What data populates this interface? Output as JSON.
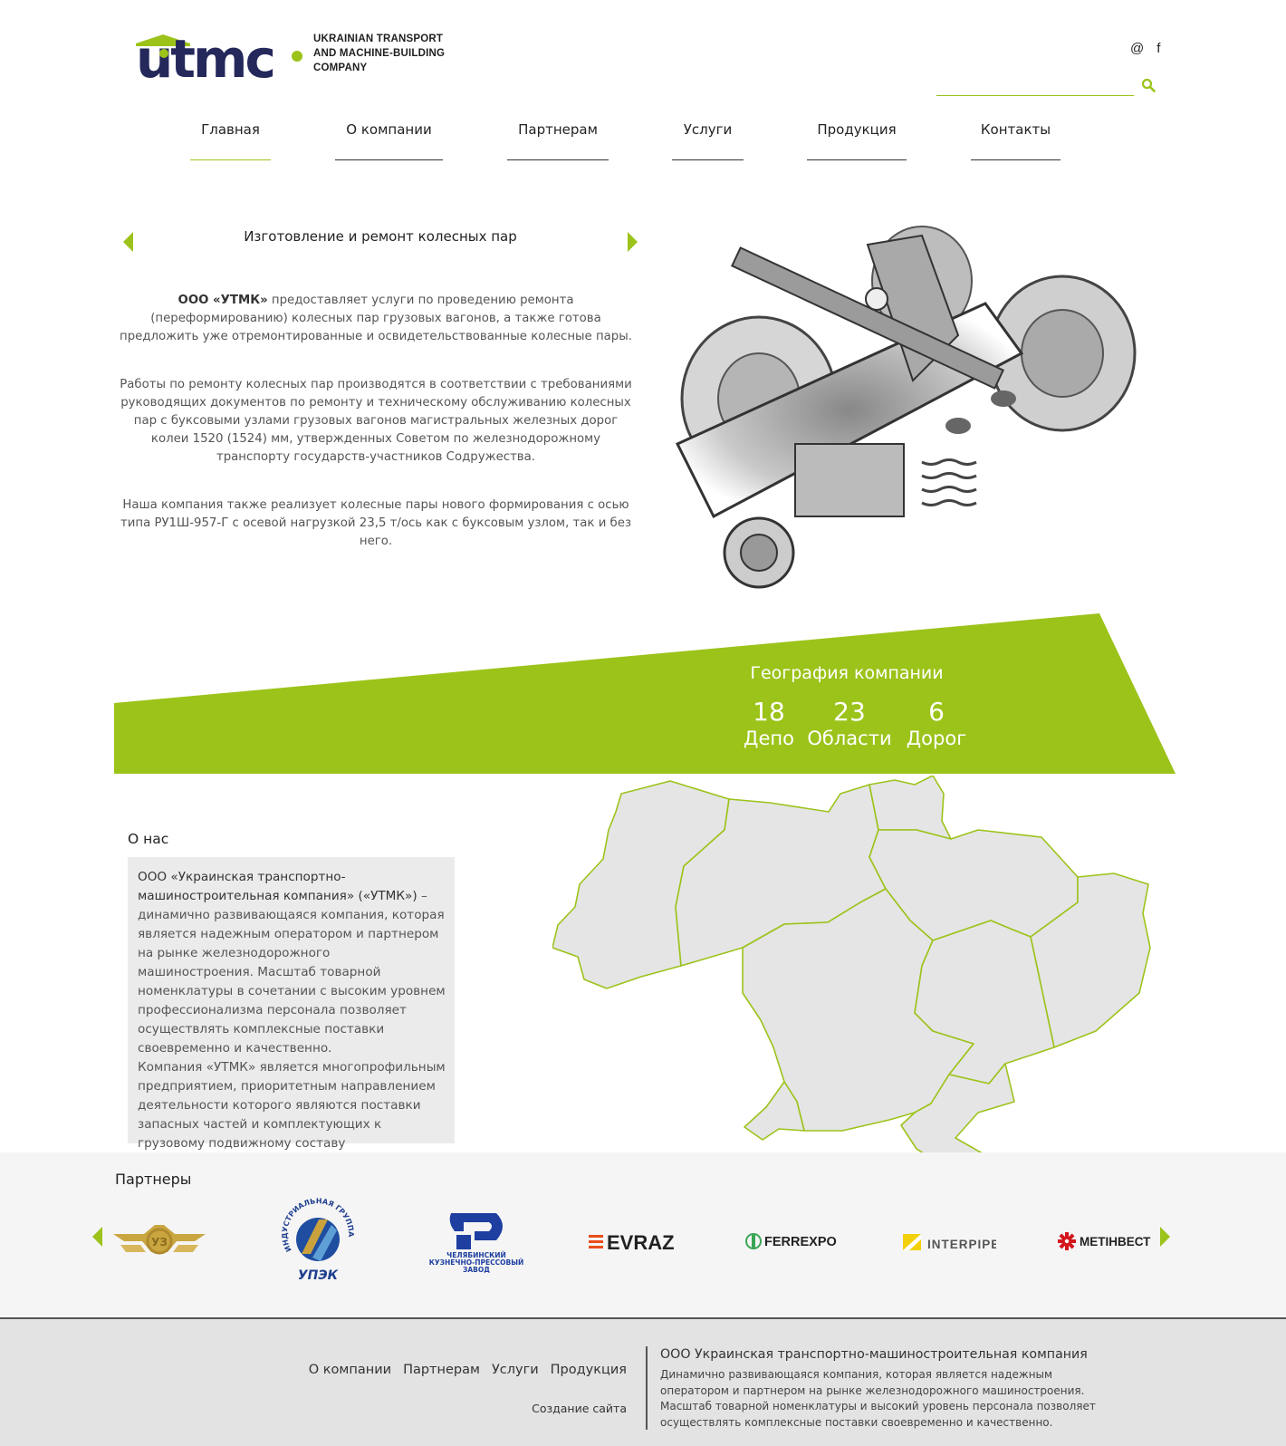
{
  "header": {
    "logo_lines": [
      "UKRAINIAN TRANSPORT",
      "AND MACHINE-BUILDING",
      "COMPANY"
    ],
    "logo_wordmark": "utmc",
    "social": [
      "@",
      "f"
    ],
    "search_placeholder": ""
  },
  "nav": {
    "items": [
      {
        "label": "Главная",
        "active": true
      },
      {
        "label": "О компании"
      },
      {
        "label": "Партнерам"
      },
      {
        "label": "Услуги"
      },
      {
        "label": "Продукция"
      },
      {
        "label": "Контакты"
      }
    ]
  },
  "slider": {
    "title": "Изготовление и ремонт колесных пар",
    "p1_company": "ООО «УТМК»",
    "p1_rest": " предоставляет услуги по проведению ремонта (переформированию) колесных пар грузовых вагонов, а также готова предложить уже отремонтированные и освидетельствованные колесные пары.",
    "p2": "Работы по ремонту колесных пар производятся в соответствии с требованиями руководящих документов по ремонту и техническому обслуживанию колесных пар с буксовыми узлами грузовых вагонов магистральных железных дорог колеи 1520 (1524) мм, утвержденных Советом по железнодорожному транспорту государств-участников Содружества.",
    "p3": "Наша компания также реализует  колесные пары нового формирования с осью типа РУ1Ш-957-Г с осевой нагрузкой 23,5 т/ось как с буксовым узлом, так и без него."
  },
  "geography": {
    "title": "География компании",
    "stats": [
      {
        "value": "18",
        "label": "Депо"
      },
      {
        "value": "23",
        "label": "Области"
      },
      {
        "value": "6",
        "label": "Дорог"
      }
    ],
    "accent_color": "#9cc31a"
  },
  "about": {
    "title": "О нас",
    "lead": "ООО «Украинская транспортно-машиностроительная компания» («УТМК»)",
    "text1": " – динамично развивающаяся компания, которая является надежным оператором и партнером на рынке железнодорожного машиностроения. Масштаб товарной номенклатуры в сочетании с высоким уровнем профессионализма персонала позволяет осуществлять комплексные поставки своевременно и качественно.",
    "text2": "Компания «УТМК» является многопрофильным предприятием, приоритетным направлением деятельности которого являются поставки запасных частей и комплектующих к грузовому подвижному составу"
  },
  "partners": {
    "title": "Партнеры",
    "logos": {
      "upek_ring": "ИНДУСТРИАЛЬНАЯ ГРУППА",
      "upek_name": "УПЭК",
      "chkpz": [
        "ЧЕЛЯБИНСКИЙ",
        "КУЗНЕЧНО-ПРЕССОВЫЙ",
        "ЗАВОД"
      ],
      "evraz": "EVRAZ",
      "ferrexpo": "FERREXPO",
      "interpipe": "INTERPIPE",
      "metinvest": "МЕТІНВЕСТ"
    }
  },
  "footer": {
    "links": [
      "О компании",
      "Партнерам",
      "Услуги",
      "Продукция"
    ],
    "credit": "Создание сайта",
    "company": "ООО Украинская транспортно-машиностроительная компания",
    "description": "Динамично развивающаяся компания, которая является надежным оператором и партнером на рынке железнодорожного машиностроения. Масштаб товарной номенклатуры и высокий уровень персонала позволяет осуществлять комплексные поставки своевременно и качественно."
  }
}
